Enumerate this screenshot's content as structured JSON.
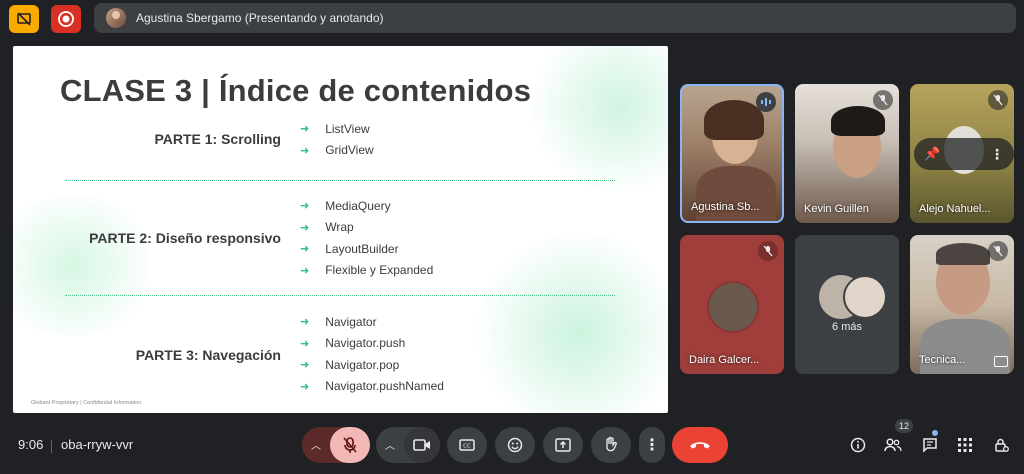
{
  "topbar": {
    "presenter_label": "Agustina Sbergamo (Presentando y anotando)"
  },
  "slide": {
    "title": "CLASE 3 | Índice de contenidos",
    "parts": [
      {
        "label": "PARTE 1: Scrolling",
        "items": [
          "ListView",
          "GridView"
        ]
      },
      {
        "label": "PARTE 2: Diseño responsivo",
        "items": [
          "MediaQuery",
          "Wrap",
          "LayoutBuilder",
          "Flexible y Expanded"
        ]
      },
      {
        "label": "PARTE 3: Navegación",
        "items": [
          "Navigator",
          "Navigator.push",
          "Navigator.pop",
          "Navigator.pushNamed"
        ]
      }
    ],
    "footer": "Globant Proprietary | Confidential Information"
  },
  "participants": [
    {
      "name": "Agustina Sb...",
      "speaking": true
    },
    {
      "name": "Kevin Guillen",
      "muted": true
    },
    {
      "name": "Alejo Nahuel...",
      "muted": true
    },
    {
      "name": "Daira Galcer...",
      "muted": true
    },
    {
      "name": "6 más"
    },
    {
      "name": "Tecnica...",
      "muted": true
    }
  ],
  "bottombar": {
    "time": "9:06",
    "meeting_code": "oba-rryw-vvr",
    "participants_count": "12"
  },
  "colors": {
    "background": "#202124",
    "accent_green": "#2ec27e",
    "hangup_red": "#ea4335",
    "mic_off_pink": "#f2b8b5",
    "speaking_blue": "#8ab4f8"
  },
  "icons": [
    "present-off-icon",
    "record-icon",
    "mic-off-icon",
    "videocam-icon",
    "captions-icon",
    "emoji-icon",
    "present-icon",
    "raise-hand-icon",
    "more-vert-icon",
    "call-end-icon",
    "info-icon",
    "people-icon",
    "chat-icon",
    "activities-icon",
    "host-controls-icon",
    "pin-icon"
  ]
}
